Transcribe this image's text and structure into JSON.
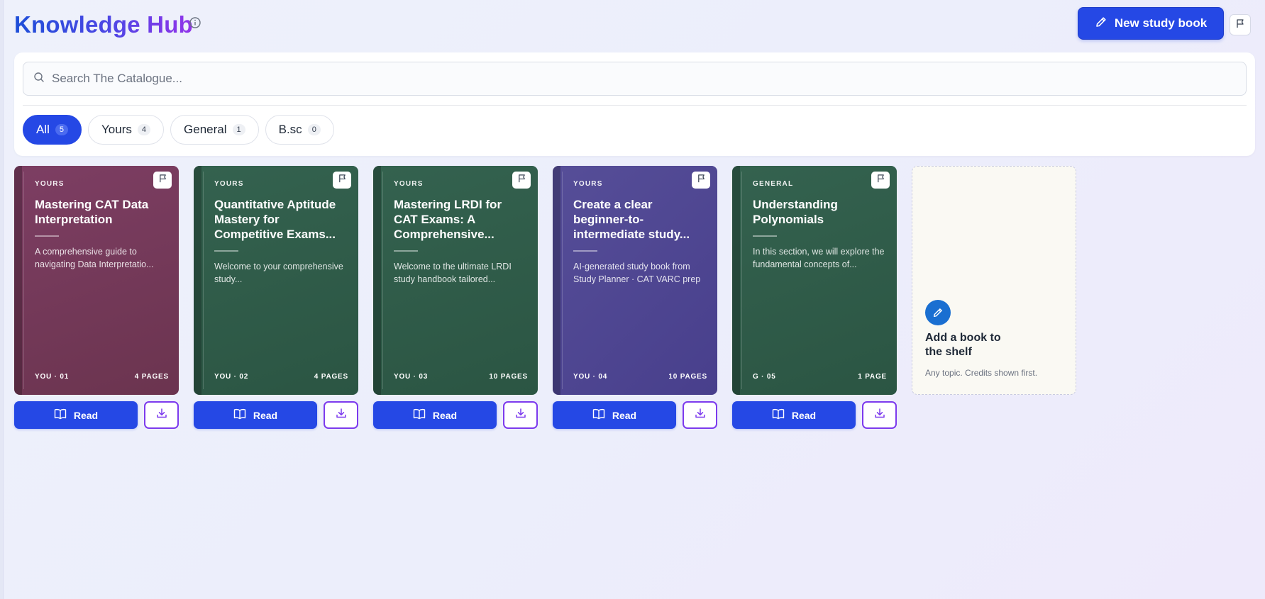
{
  "header": {
    "title": "Knowledge Hub",
    "new_book_label": "New study book"
  },
  "search": {
    "placeholder": "Search The Catalogue..."
  },
  "tabs": [
    {
      "label": "All",
      "count": "5",
      "active": true
    },
    {
      "label": "Yours",
      "count": "4",
      "active": false
    },
    {
      "label": "General",
      "count": "1",
      "active": false
    },
    {
      "label": "B.sc",
      "count": "0",
      "active": false
    }
  ],
  "books": [
    {
      "tag": "YOURS",
      "title": "Mastering CAT Data Interpretation",
      "desc": "A comprehensive guide to navigating Data Interpretatio...",
      "code": "YOU · 01",
      "pages": "4 PAGES",
      "color": "#7d3e63"
    },
    {
      "tag": "YOURS",
      "title": "Quantitative Aptitude Mastery for Competitive Exams...",
      "desc": "Welcome to your comprehensive study...",
      "code": "YOU · 02",
      "pages": "4 PAGES",
      "color": "#34624f"
    },
    {
      "tag": "YOURS",
      "title": "Mastering LRDI for CAT Exams: A Comprehensive...",
      "desc": "Welcome to the ultimate LRDI study handbook tailored...",
      "code": "YOU · 03",
      "pages": "10 PAGES",
      "color": "#34624f"
    },
    {
      "tag": "YOURS",
      "title": "Create a clear beginner-to-intermediate study...",
      "desc": "AI-generated study book from Study Planner · CAT VARC prep",
      "code": "YOU · 04",
      "pages": "10 PAGES",
      "color": "#564e98"
    },
    {
      "tag": "GENERAL",
      "title": "Understanding Polynomials",
      "desc": "In this section, we will explore the fundamental concepts of...",
      "code": "G · 05",
      "pages": "1 PAGE",
      "color": "#34624f"
    }
  ],
  "actions": {
    "read_label": "Read"
  },
  "add_card": {
    "title": "Add a book to the shelf",
    "subtitle": "Any topic. Credits shown first."
  },
  "colors": {
    "accent": "#2548e5",
    "download_border": "#7c3aed",
    "add_icon": "#1a6fd1"
  },
  "icons": {
    "info": "info-icon",
    "pencil": "pencil-icon",
    "flag": "flag-icon",
    "search": "search-icon",
    "book_open": "book-open-icon",
    "download": "download-icon"
  }
}
